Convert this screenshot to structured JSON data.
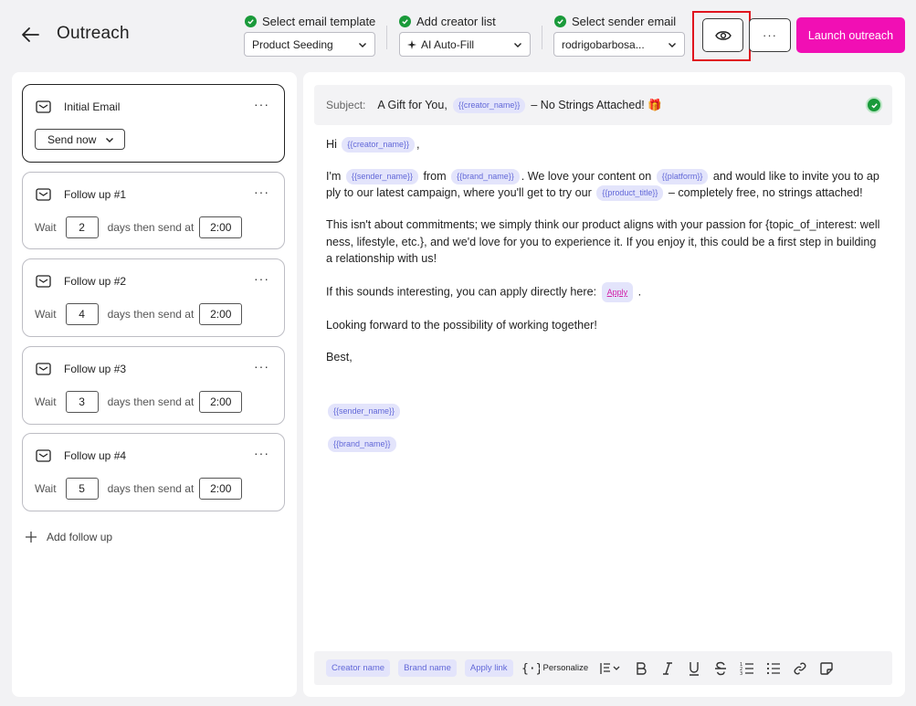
{
  "header": {
    "title": "Outreach",
    "steps": [
      {
        "label": "Select email template",
        "value": "Product Seeding"
      },
      {
        "label": "Add creator list",
        "value": "AI Auto-Fill"
      },
      {
        "label": "Select sender email",
        "value": "rodrigobarbosa..."
      }
    ],
    "more_label": "···",
    "launch_label": "Launch outreach"
  },
  "sequence": {
    "initial": {
      "title": "Initial Email",
      "send_label": "Send now",
      "more": "···"
    },
    "followups": [
      {
        "title": "Follow up #1",
        "wait_label": "Wait",
        "days": "2",
        "then_label": "days then send at",
        "time": "2:00",
        "more": "···"
      },
      {
        "title": "Follow up #2",
        "wait_label": "Wait",
        "days": "4",
        "then_label": "days then send at",
        "time": "2:00",
        "more": "···"
      },
      {
        "title": "Follow up #3",
        "wait_label": "Wait",
        "days": "3",
        "then_label": "days then send at",
        "time": "2:00",
        "more": "···"
      },
      {
        "title": "Follow up #4",
        "wait_label": "Wait",
        "days": "5",
        "then_label": "days then send at",
        "time": "2:00",
        "more": "···"
      }
    ],
    "add_label": "Add follow up"
  },
  "email": {
    "subject_label": "Subject:",
    "subject_pre": "A Gift for You,",
    "subject_tag": "{{creator_name}}",
    "subject_post": "– No Strings Attached! 🎁",
    "greeting": "Hi",
    "greeting_tag": "{{creator_name}}",
    "greeting_end": ",",
    "p1_a": "I'm",
    "p1_tag1": "{{sender_name}}",
    "p1_b": "from",
    "p1_tag2": "{{brand_name}}",
    "p1_c": ". We love your content on",
    "p1_tag3": "{{platform}}",
    "p1_d": "and would like to invite you to apply to our latest campaign, where you'll get to try our",
    "p1_tag4": "{{product_title}}",
    "p1_e": "– completely free, no strings attached!",
    "p2": "This isn't about commitments; we simply think our product aligns with your passion for {topic_of_interest: wellness, lifestyle, etc.}, and we'd love for you to experience it. If you enjoy it, this could be a first step in building a relationship with us!",
    "p3_a": "If this sounds interesting, you can apply directly here:",
    "p3_link": "Apply",
    "p3_end": ".",
    "p4": "Looking forward to the possibility of working together!",
    "p5": "Best,",
    "sig_tag1": "{{sender_name}}",
    "sig_tag2": "{{brand_name}}"
  },
  "toolbar": {
    "chips": [
      "Creator name",
      "Brand name",
      "Apply link"
    ],
    "personalize_label": "Personalize"
  },
  "colors": {
    "accent": "#f10fb4",
    "success": "#1a9a3a",
    "tag_bg": "#e3e4fb",
    "tag_text": "#6268d8",
    "highlight": "#e0141e"
  }
}
